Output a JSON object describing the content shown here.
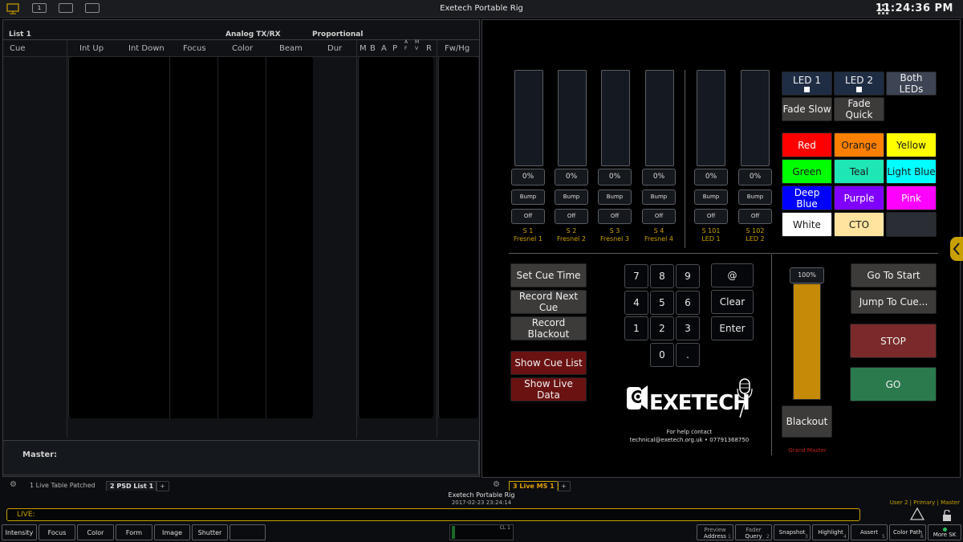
{
  "topbar": {
    "title": "Exetech Portable Rig",
    "clock": "11:24:36 PM",
    "icon_small": "1"
  },
  "left": {
    "list_title": "List 1",
    "analog": "Analog TX/RX",
    "proportional": "Proportional",
    "columns": [
      "Cue",
      "Int Up",
      "Int Down",
      "Focus",
      "Color",
      "Beam",
      "Dur",
      "M",
      "B",
      "A",
      "P",
      "A F",
      "M V",
      "R",
      "Fw/Hg"
    ],
    "master_label": "Master:"
  },
  "tabs_left": [
    "1 Live Table Patched",
    "2 PSD List 1",
    "+"
  ],
  "tabs_right": [
    "3 Live MS 1",
    "+"
  ],
  "channels": [
    {
      "pct": "0%",
      "bump": "Bump",
      "off": "Off",
      "num": "S 1",
      "name": "Fresnel 1"
    },
    {
      "pct": "0%",
      "bump": "Bump",
      "off": "Off",
      "num": "S 2",
      "name": "Fresnel 2"
    },
    {
      "pct": "0%",
      "bump": "Bump",
      "off": "Off",
      "num": "S 3",
      "name": "Fresnel 3"
    },
    {
      "pct": "0%",
      "bump": "Bump",
      "off": "Off",
      "num": "S 4",
      "name": "Fresnel 4"
    },
    {
      "pct": "0%",
      "bump": "Bump",
      "off": "Off",
      "num": "S 101",
      "name": "LED 1"
    },
    {
      "pct": "0%",
      "bump": "Bump",
      "off": "Off",
      "num": "S 102",
      "name": "LED 2"
    }
  ],
  "led_controls": {
    "led1": "LED 1",
    "led2": "LED 2",
    "both": "Both LEDs",
    "fade_slow": "Fade Slow",
    "fade_quick": "Fade Quick"
  },
  "colors": [
    {
      "label": "Red",
      "bg": "#ff0000",
      "fg": "#ffffff"
    },
    {
      "label": "Orange",
      "bg": "#ff8000",
      "fg": "#1a1a1a"
    },
    {
      "label": "Yellow",
      "bg": "#ffff00",
      "fg": "#1a1a1a"
    },
    {
      "label": "Green",
      "bg": "#00ff00",
      "fg": "#1a1a1a"
    },
    {
      "label": "Teal",
      "bg": "#1ee6b4",
      "fg": "#1a1a1a"
    },
    {
      "label": "Light Blue",
      "bg": "#00ffff",
      "fg": "#1a1a1a"
    },
    {
      "label": "Deep Blue",
      "bg": "#0000ff",
      "fg": "#ffffff"
    },
    {
      "label": "Purple",
      "bg": "#8000ff",
      "fg": "#ffffff"
    },
    {
      "label": "Pink",
      "bg": "#ff00ff",
      "fg": "#ffffff"
    },
    {
      "label": "White",
      "bg": "#ffffff",
      "fg": "#1a1a1a"
    },
    {
      "label": "CTO",
      "bg": "#ffe4a0",
      "fg": "#1a1a1a"
    },
    {
      "label": "",
      "bg": "#2a2d33",
      "fg": "#ffffff"
    }
  ],
  "cue_actions": {
    "set_cue_time": "Set Cue Time",
    "record_next": "Record Next Cue",
    "record_blackout": "Record Blackout",
    "show_cue_list": "Show Cue List",
    "show_live_data": "Show Live Data"
  },
  "keypad": {
    "k7": "7",
    "k8": "8",
    "k9": "9",
    "k4": "4",
    "k5": "5",
    "k6": "6",
    "k1": "1",
    "k2": "2",
    "k3": "3",
    "k0": "0",
    "kdot": ".",
    "at": "@",
    "clear": "Clear",
    "enter": "Enter"
  },
  "logo": {
    "text": "EXETECH",
    "help1": "For help contact",
    "help2": "technical@exetech.org.uk • 07791368750"
  },
  "grand_master": {
    "pct": "100%",
    "level": 1.0,
    "blackout": "Blackout",
    "label": "Grand Master"
  },
  "playback": {
    "go_to_start": "Go To Start",
    "jump_to_cue": "Jump To Cue...",
    "stop": "STOP",
    "go": "GO"
  },
  "status": {
    "rig": "Exetech Portable Rig",
    "datetime": "2017-02-23 23:24:14",
    "user": "User 2 | Primary | Master",
    "live": "LIVE:"
  },
  "bottom_left": [
    "Intensity",
    "Focus",
    "Color",
    "Form",
    "Image",
    "Shutter",
    ""
  ],
  "cl_label": "CL 1",
  "bottom_right": [
    {
      "top": "Preview",
      "bot": "Address",
      "n": "1"
    },
    {
      "top": "Fader",
      "bot": "Query",
      "n": "2"
    },
    {
      "top": "",
      "bot": "Snapshot",
      "n": "3"
    },
    {
      "top": "",
      "bot": "Highlight",
      "n": "4"
    },
    {
      "top": "",
      "bot": "Assert",
      "n": "5"
    },
    {
      "top": "",
      "bot": "Color Path",
      "n": "6"
    },
    {
      "top": "",
      "bot": "More SK",
      "n": ""
    }
  ]
}
